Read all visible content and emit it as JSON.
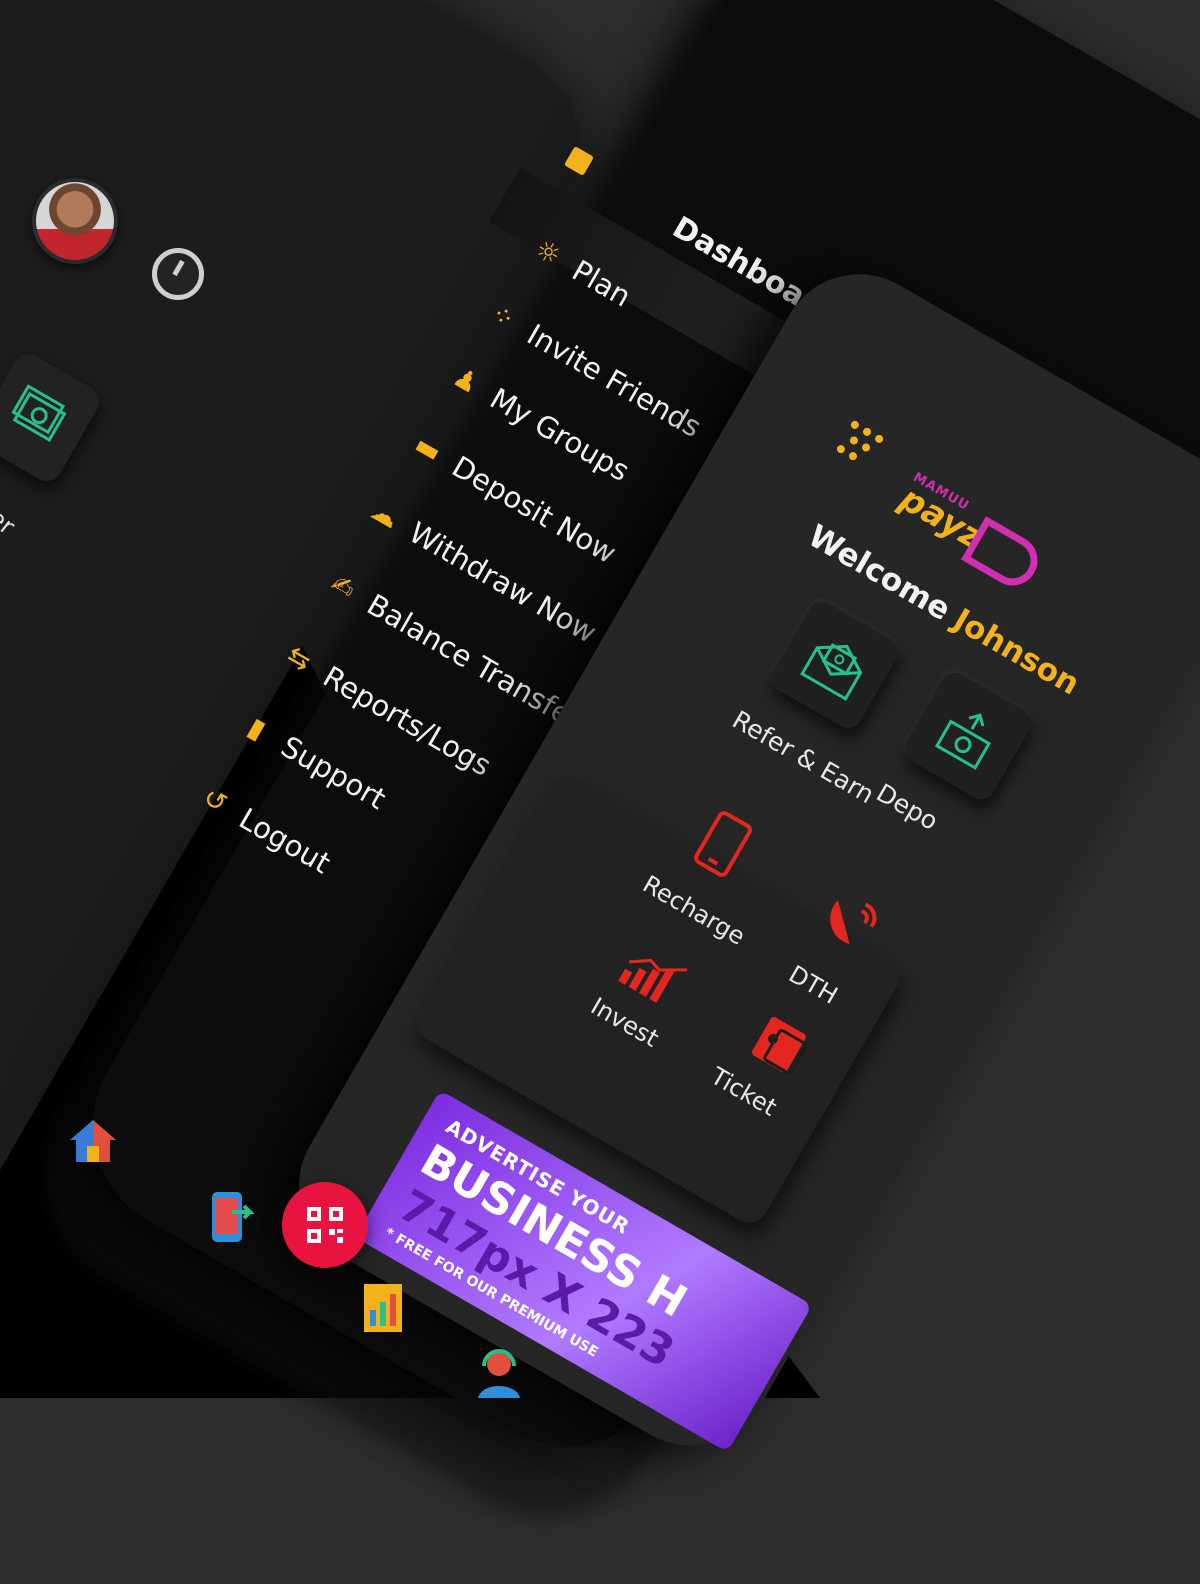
{
  "menu": {
    "dashboard_title": "Dashboard",
    "items": [
      {
        "label": "Plan",
        "icon": "lightbulb-icon"
      },
      {
        "label": "Invite Friends",
        "icon": "invite-icon"
      },
      {
        "label": "My Groups",
        "icon": "groups-icon"
      },
      {
        "label": "Deposit Now",
        "icon": "wallet-icon"
      },
      {
        "label": "Withdraw Now",
        "icon": "cloud-download-icon"
      },
      {
        "label": "Balance Transfer",
        "icon": "hand-coin-icon"
      },
      {
        "label": "Reports/Logs",
        "icon": "transfer-arrows-icon"
      },
      {
        "label": "Support",
        "icon": "ticket-icon"
      },
      {
        "label": "Logout",
        "icon": "logout-icon"
      }
    ]
  },
  "brand": {
    "top": "MAMUU",
    "name": "payz"
  },
  "welcome": {
    "greeting": "Welcome",
    "name": "Johnson"
  },
  "quick_tiles": [
    {
      "label": "Refer & Earn",
      "icon": "envelope-money-icon"
    },
    {
      "label": "Depo",
      "icon": "deposit-icon"
    }
  ],
  "services": [
    {
      "label": "Recharge",
      "icon": "mobile-phone-icon"
    },
    {
      "label": "DTH",
      "icon": "satellite-dish-icon"
    },
    {
      "label": "Invest",
      "icon": "chart-growth-icon"
    },
    {
      "label": "Ticket",
      "icon": "ticket-icon"
    }
  ],
  "banner": {
    "line1": "ADVERTISE YOUR",
    "line2": "BUSINESS H",
    "line3": "717px X 223",
    "line4": "* FREE FOR OUR PREMIUM USE"
  },
  "left_screen": {
    "tile_label": "fer"
  },
  "colors": {
    "accent": "#f3b21b",
    "brand_pink": "#cf2fb0",
    "service_red": "#e3261f",
    "tile_green": "#27c08a",
    "qr_red": "#e8143f"
  }
}
